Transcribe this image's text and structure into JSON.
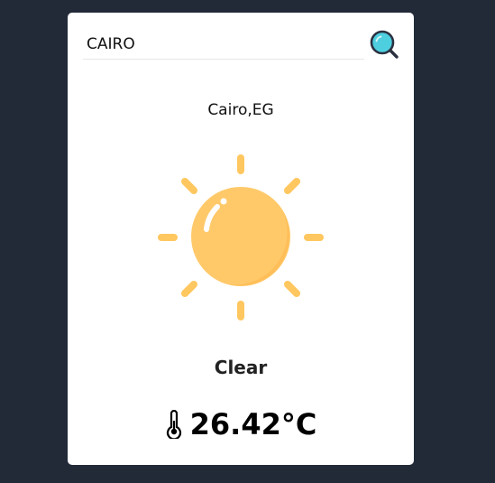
{
  "search": {
    "value": "CAIRO",
    "placeholder": ""
  },
  "location": {
    "label": "Cairo,EG"
  },
  "weather": {
    "condition": "Clear",
    "temperature": "26.42°C",
    "icon": "sun-icon"
  },
  "icons": {
    "search": "magnifier-icon",
    "thermometer": "thermometer-icon"
  },
  "colors": {
    "background": "#222a38",
    "card": "#ffffff",
    "search_accent": "#4ecfe0",
    "search_outline": "#2b3140",
    "sun": "#ffc75f"
  }
}
